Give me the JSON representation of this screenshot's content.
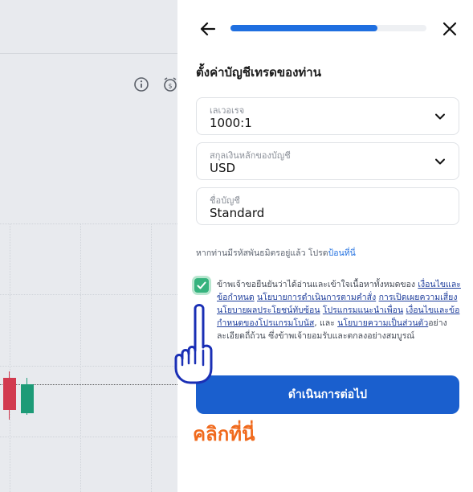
{
  "colors": {
    "accent": "#1a5fce",
    "progress": "#1f6fe0",
    "checkbox": "#36b37e",
    "click_here": "#f06a1d",
    "candle_bear": "#d23a4f",
    "candle_bull": "#1d9b77"
  },
  "progress": {
    "fraction": 0.75
  },
  "header": {
    "back_icon": "arrow-left-icon",
    "close_icon": "close-icon"
  },
  "title": "ตั้งค่าบัญชีเทรดของท่าน",
  "fields": {
    "leverage": {
      "label": "เลเวอเรจ",
      "value": "1000:1"
    },
    "currency": {
      "label": "สกุลเงินหลักของบัญชี",
      "value": "USD"
    },
    "account_name": {
      "label": "ชื่อบัญชี",
      "value": "Standard"
    }
  },
  "promo": {
    "text": "หากท่านมีรหัสพันธมิตรอยู่แล้ว โปรด",
    "link": "ป้อนที่นี่"
  },
  "terms": {
    "checked": true,
    "intro": "ข้าพเจ้าขอยืนยันว่าได้อ่านและเข้าใจเนื้อหาทั้งหมดของ ",
    "link1": "เงื่อนไขและข้อกำหนด",
    "sep1": " ",
    "link2": "นโยบายการดำเนินการตามคำสั่ง",
    "sep2": " ",
    "link3": "การเปิดเผยความเสี่ยง",
    "sep3": " ",
    "link4": "นโยบายผลประโยชน์ทับซ้อน",
    "sep4": " ",
    "link5": "โปรแกรมแนะนำเพื่อน",
    "sep5": " ",
    "link6": "เงื่อนไขและข้อกำหนดของโปรแกรมโบนัส",
    "sep6": ", และ ",
    "link7": "นโยบายความเป็นส่วนตัว",
    "outro": "อย่างละเอียดถี่ถ้วน ซึ่งข้าพเจ้ายอมรับและตกลงอย่างสมบูรณ์"
  },
  "continue_button": "ดำเนินการต่อไป",
  "click_here": "คลิกที่นี่",
  "chart_toolbar": {
    "info_icon": "info-icon",
    "alarm_icon": "alarm-clock-icon"
  }
}
